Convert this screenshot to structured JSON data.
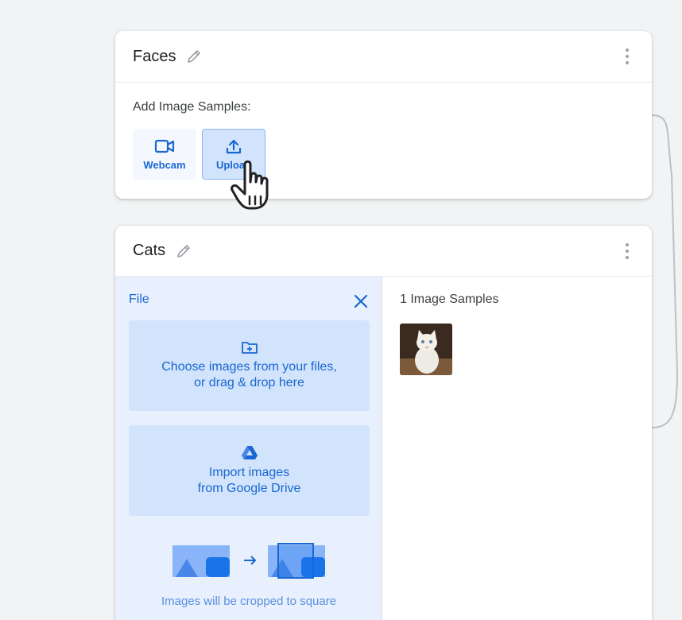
{
  "faces_card": {
    "title": "Faces",
    "add_samples_label": "Add Image Samples:",
    "webcam_label": "Webcam",
    "upload_label": "Upload"
  },
  "cats_card": {
    "title": "Cats",
    "file_label": "File",
    "choose_files_line1": "Choose images from your files,",
    "choose_files_line2": "or drag & drop here",
    "drive_line1": "Import images",
    "drive_line2": "from Google Drive",
    "crop_note": "Images will be cropped to square",
    "samples_title": "1 Image Samples"
  },
  "icons": {
    "edit": "pencil-icon",
    "more": "kebab-menu-icon",
    "webcam": "video-camera-icon",
    "upload": "upload-icon",
    "close": "close-icon",
    "folder": "folder-add-icon",
    "drive": "google-drive-icon",
    "cursor": "hand-pointer-icon"
  },
  "colors": {
    "accent": "#1967d2",
    "panel_bg": "#e8f0fe",
    "box_bg": "#d2e3fc",
    "page_bg": "#f1f3f4"
  }
}
